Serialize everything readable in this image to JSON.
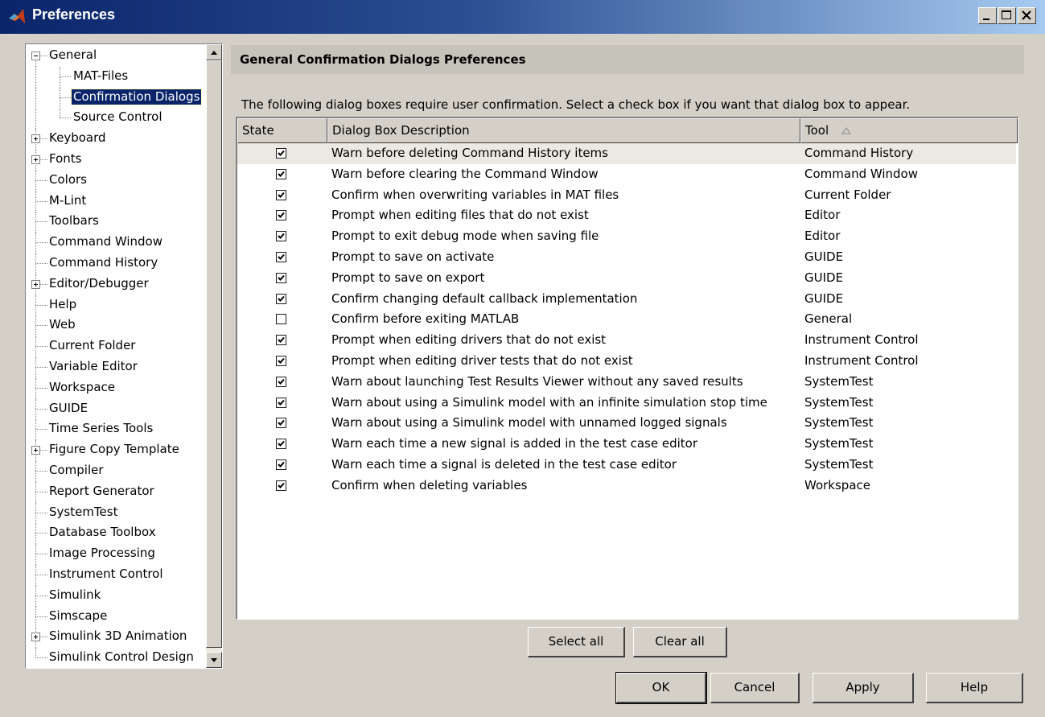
{
  "window": {
    "title": "Preferences",
    "controls": [
      "minimize-icon",
      "maximize-icon",
      "close-icon"
    ]
  },
  "tree": {
    "items": [
      {
        "label": "General",
        "level": 0,
        "expander": "minus"
      },
      {
        "label": "MAT-Files",
        "level": 1
      },
      {
        "label": "Confirmation Dialogs",
        "level": 1,
        "selected": true
      },
      {
        "label": "Source Control",
        "level": 1
      },
      {
        "label": "Keyboard",
        "level": 0,
        "expander": "plus"
      },
      {
        "label": "Fonts",
        "level": 0,
        "expander": "plus"
      },
      {
        "label": "Colors",
        "level": 0
      },
      {
        "label": "M-Lint",
        "level": 0
      },
      {
        "label": "Toolbars",
        "level": 0
      },
      {
        "label": "Command Window",
        "level": 0
      },
      {
        "label": "Command History",
        "level": 0
      },
      {
        "label": "Editor/Debugger",
        "level": 0,
        "expander": "plus"
      },
      {
        "label": "Help",
        "level": 0
      },
      {
        "label": "Web",
        "level": 0
      },
      {
        "label": "Current Folder",
        "level": 0
      },
      {
        "label": "Variable Editor",
        "level": 0
      },
      {
        "label": "Workspace",
        "level": 0
      },
      {
        "label": "GUIDE",
        "level": 0
      },
      {
        "label": "Time Series Tools",
        "level": 0
      },
      {
        "label": "Figure Copy Template",
        "level": 0,
        "expander": "plus"
      },
      {
        "label": "Compiler",
        "level": 0
      },
      {
        "label": "Report Generator",
        "level": 0
      },
      {
        "label": "SystemTest",
        "level": 0
      },
      {
        "label": "Database Toolbox",
        "level": 0
      },
      {
        "label": "Image Processing",
        "level": 0
      },
      {
        "label": "Instrument Control",
        "level": 0
      },
      {
        "label": "Simulink",
        "level": 0
      },
      {
        "label": "Simscape",
        "level": 0
      },
      {
        "label": "Simulink 3D Animation",
        "level": 0,
        "expander": "plus"
      },
      {
        "label": "Simulink Control Design",
        "level": 0
      }
    ]
  },
  "panel": {
    "title": "General Confirmation Dialogs Preferences",
    "intro": "The following dialog boxes require user confirmation.  Select a check box if you want that dialog box to appear."
  },
  "table": {
    "columns": [
      "State",
      "Dialog Box Description",
      "Tool"
    ],
    "sort_indicator": "sort-ascending-icon",
    "rows": [
      {
        "checked": true,
        "description": "Warn before deleting Command History items",
        "tool": "Command History"
      },
      {
        "checked": true,
        "description": "Warn before clearing the Command Window",
        "tool": "Command Window"
      },
      {
        "checked": true,
        "description": "Confirm when overwriting variables in MAT files",
        "tool": "Current Folder"
      },
      {
        "checked": true,
        "description": "Prompt when editing files that do not exist",
        "tool": "Editor"
      },
      {
        "checked": true,
        "description": "Prompt to exit debug mode when saving file",
        "tool": "Editor"
      },
      {
        "checked": true,
        "description": "Prompt to save on activate",
        "tool": "GUIDE"
      },
      {
        "checked": true,
        "description": "Prompt to save on export",
        "tool": "GUIDE"
      },
      {
        "checked": true,
        "description": "Confirm changing default callback implementation",
        "tool": "GUIDE"
      },
      {
        "checked": false,
        "description": "Confirm before exiting MATLAB",
        "tool": "General"
      },
      {
        "checked": true,
        "description": "Prompt when editing drivers that do not exist",
        "tool": "Instrument Control"
      },
      {
        "checked": true,
        "description": "Prompt when editing driver tests that do not exist",
        "tool": "Instrument Control"
      },
      {
        "checked": true,
        "description": "Warn about launching Test Results Viewer without any saved results",
        "tool": "SystemTest"
      },
      {
        "checked": true,
        "description": "Warn about using a Simulink model with an infinite simulation stop time",
        "tool": "SystemTest"
      },
      {
        "checked": true,
        "description": "Warn about using a Simulink model with unnamed logged signals",
        "tool": "SystemTest"
      },
      {
        "checked": true,
        "description": "Warn each time a new signal is added in the test case editor",
        "tool": "SystemTest"
      },
      {
        "checked": true,
        "description": "Warn each time a signal is deleted in the test case editor",
        "tool": "SystemTest"
      },
      {
        "checked": true,
        "description": "Confirm when deleting variables",
        "tool": "Workspace"
      }
    ]
  },
  "buttons": {
    "select_all": "Select all",
    "clear_all": "Clear all",
    "ok": "OK",
    "cancel": "Cancel",
    "apply": "Apply",
    "help": "Help"
  },
  "colors": {
    "titlebar_start": "#0a246a",
    "titlebar_end": "#a6caf0",
    "selection": "#0a246a",
    "face": "#d4d0c8"
  }
}
